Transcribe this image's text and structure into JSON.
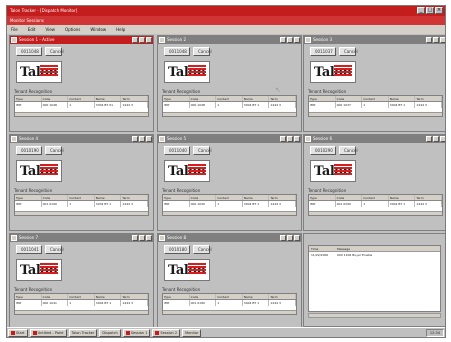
{
  "window": {
    "title": "Talon Tracker - [Dispatch Monitor]",
    "subtitle": "Monitor Sessions"
  },
  "menubar": [
    "File",
    "Edit",
    "View",
    "Options",
    "Window",
    "Help"
  ],
  "panes": [
    {
      "title": "Session 1 - Active",
      "id_btn": "0011048",
      "cancel_btn": "Cancel",
      "section": "Tenant Recognition",
      "active": true,
      "headers": [
        "Type",
        "Code",
        "Contact",
        "Name",
        "Term"
      ],
      "rows": [
        [
          "IMP",
          "000 1048",
          "1",
          "3304 BT 01",
          "1444 3"
        ]
      ]
    },
    {
      "title": "Session 2",
      "id_btn": "0011048",
      "cancel_btn": "Cancel",
      "section": "Tenant Recognition",
      "active": false,
      "headers": [
        "Type",
        "Code",
        "Contact",
        "Name",
        "Term"
      ],
      "rows": [
        [
          "IMP",
          "000 1048",
          "1",
          "3004 BT 1",
          "1444 3"
        ]
      ]
    },
    {
      "title": "Session 3",
      "id_btn": "0011037",
      "cancel_btn": "Cancel",
      "section": "Tenant Recognition",
      "active": false,
      "headers": [
        "Type",
        "Code",
        "Contact",
        "Name",
        "Term"
      ],
      "rows": [
        [
          "IMP",
          "000 1037",
          "1",
          "3004 BT 1",
          "1444 3"
        ]
      ]
    },
    {
      "title": "Session 4",
      "id_btn": "0010190",
      "cancel_btn": "Cancel",
      "section": "Tenant Recognition",
      "active": false,
      "headers": [
        "Type",
        "Code",
        "Contact",
        "Name",
        "Term"
      ],
      "rows": [
        [
          "IMP",
          "001 0190",
          "1",
          "3204 BT 1",
          "1444 3"
        ]
      ]
    },
    {
      "title": "Session 5",
      "id_btn": "0011040",
      "cancel_btn": "Cancel",
      "section": "Tenant Recognition",
      "active": false,
      "headers": [
        "Type",
        "Code",
        "Contact",
        "Name",
        "Term"
      ],
      "rows": [
        [
          "IMP",
          "000 1040",
          "1",
          "3004 BT 1",
          "1444 3"
        ]
      ]
    },
    {
      "title": "Session 6",
      "id_btn": "0010290",
      "cancel_btn": "Cancel",
      "section": "Tenant Recognition",
      "active": false,
      "headers": [
        "Type",
        "Code",
        "Contact",
        "Name",
        "Term"
      ],
      "rows": [
        [
          "IMP",
          "001 0290",
          "1",
          "3004 BT 1",
          "1444 3"
        ]
      ]
    },
    {
      "title": "Session 7",
      "id_btn": "0011041",
      "cancel_btn": "Cancel",
      "section": "Tenant Recognition",
      "active": false,
      "headers": [
        "Type",
        "Code",
        "Contact",
        "Name",
        "Term"
      ],
      "rows": [
        [
          "IMP",
          "000 1041",
          "1",
          "3004 BT 1",
          "1444 3"
        ]
      ]
    },
    {
      "title": "Session 8",
      "id_btn": "0010180",
      "cancel_btn": "Cancel",
      "section": "Tenant Recognition",
      "active": false,
      "headers": [
        "Type",
        "Code",
        "Contact",
        "Name",
        "Term"
      ],
      "rows": [
        [
          "IMP",
          "001 0180",
          "1",
          "3004 BT 1",
          "1444 3"
        ]
      ]
    }
  ],
  "logpane": {
    "headers": [
      "Time",
      "Message"
    ],
    "rows": [
      [
        "11/22/2000",
        "000 1106 Buyer Enable"
      ]
    ]
  },
  "logo": {
    "text": "Talon"
  },
  "taskbar": {
    "items": [
      "Start",
      "Untitled - Paint",
      "Talon Tracker",
      "Dispatch",
      "Session 1",
      "Session 2",
      "Monitor"
    ],
    "clock": "12:34"
  },
  "colors": {
    "accent": "#c41d1d",
    "chrome": "#c0c0c0"
  }
}
